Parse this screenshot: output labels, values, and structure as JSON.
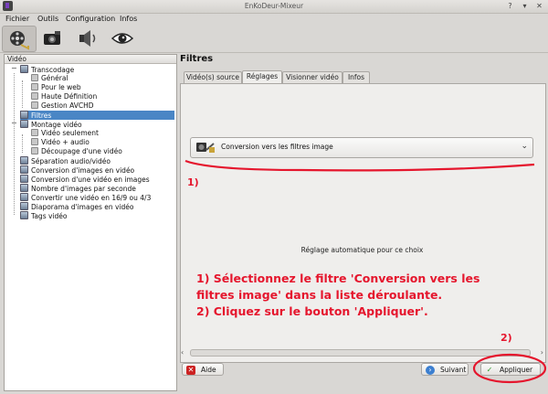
{
  "window": {
    "title": "EnKoDeur-Mixeur"
  },
  "menu": [
    "Fichier",
    "Outils",
    "Configuration",
    "Infos"
  ],
  "toolbar": [
    {
      "icon": "film-reel-icon"
    },
    {
      "icon": "camera-icon"
    },
    {
      "icon": "speaker-icon"
    },
    {
      "icon": "eye-icon"
    }
  ],
  "tree": {
    "header": "Vidéo",
    "items": [
      {
        "label": "Transcodage",
        "level": 1
      },
      {
        "label": "Général",
        "level": 2
      },
      {
        "label": "Pour le web",
        "level": 2
      },
      {
        "label": "Haute Définition",
        "level": 2
      },
      {
        "label": "Gestion AVCHD",
        "level": 2
      },
      {
        "label": "Filtres",
        "level": 1
      },
      {
        "label": "Montage vidéo",
        "level": 1
      },
      {
        "label": "Vidéo seulement",
        "level": 2
      },
      {
        "label": "Vidéo + audio",
        "level": 2
      },
      {
        "label": "Découpage d'une vidéo",
        "level": 2
      },
      {
        "label": "Séparation audio/vidéo",
        "level": 1
      },
      {
        "label": "Conversion d'images en vidéo",
        "level": 1
      },
      {
        "label": "Conversion d'une vidéo en images",
        "level": 1
      },
      {
        "label": "Nombre d'images par seconde",
        "level": 1
      },
      {
        "label": "Convertir une vidéo en 16/9 ou 4/3",
        "level": 1
      },
      {
        "label": "Diaporama d'images en vidéo",
        "level": 1
      },
      {
        "label": "Tags vidéo",
        "level": 1
      }
    ],
    "selected": "Filtres"
  },
  "panel": {
    "title": "Filtres",
    "tabs": [
      "Vidéo(s) source",
      "Réglages",
      "Visionner vidéo",
      "Infos"
    ],
    "active_tab": "Réglages",
    "filter_select": "Conversion vers les filtres image",
    "auto_text": "Réglage automatique pour ce choix"
  },
  "buttons": {
    "help": "Aide",
    "next": "Suivant",
    "apply": "Appliquer"
  },
  "annotations": {
    "marker1": "1)",
    "line1": "1) Sélectionnez le filtre 'Conversion vers les",
    "line2": "filtres image' dans la liste déroulante.",
    "line3": "2) Cliquez sur le bouton 'Appliquer'.",
    "marker2": "2)",
    "color": "#e5162d"
  }
}
